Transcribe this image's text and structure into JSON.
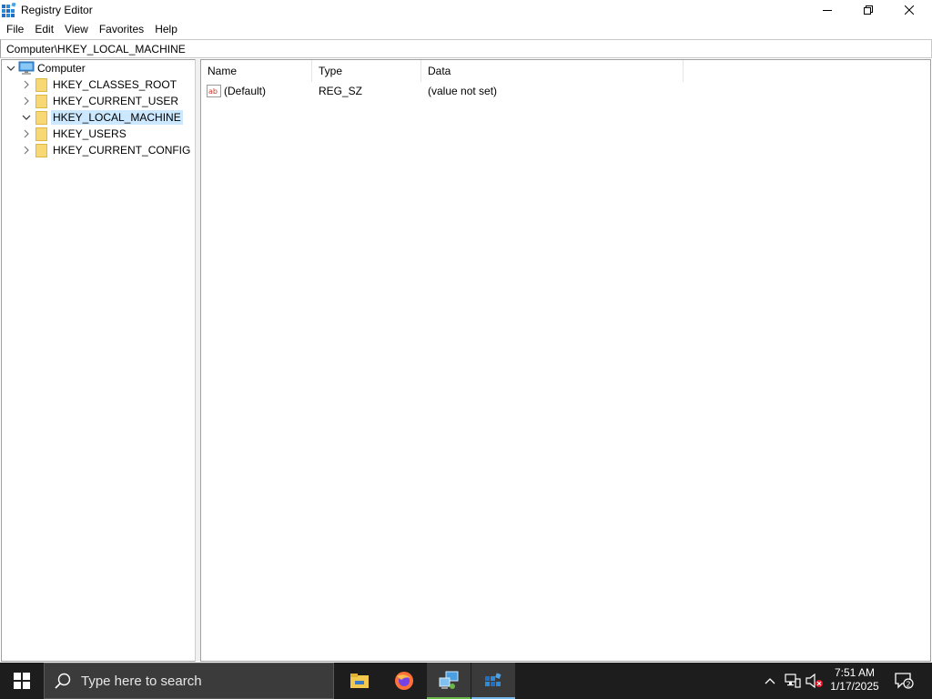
{
  "window": {
    "title": "Registry Editor",
    "controls": {
      "minimize": "minimize",
      "maximize": "restore",
      "close": "close"
    }
  },
  "menu": [
    "File",
    "Edit",
    "View",
    "Favorites",
    "Help"
  ],
  "address": {
    "value": "Computer\\HKEY_LOCAL_MACHINE"
  },
  "tree": {
    "root": {
      "label": "Computer",
      "expanded": true
    },
    "keys": [
      {
        "label": "HKEY_CLASSES_ROOT",
        "expanded": false,
        "selected": false
      },
      {
        "label": "HKEY_CURRENT_USER",
        "expanded": false,
        "selected": false
      },
      {
        "label": "HKEY_LOCAL_MACHINE",
        "expanded": true,
        "selected": true
      },
      {
        "label": "HKEY_USERS",
        "expanded": false,
        "selected": false
      },
      {
        "label": "HKEY_CURRENT_CONFIG",
        "expanded": false,
        "selected": false
      }
    ]
  },
  "list": {
    "columns": [
      "Name",
      "Type",
      "Data"
    ],
    "rows": [
      {
        "name": "(Default)",
        "type": "REG_SZ",
        "data": "(value not set)",
        "icon": "string-value-icon"
      }
    ]
  },
  "taskbar": {
    "search_placeholder": "Type here to search",
    "apps": [
      {
        "name": "file-explorer",
        "active": false
      },
      {
        "name": "firefox",
        "active": false
      },
      {
        "name": "network-tool",
        "active": true
      },
      {
        "name": "registry-editor",
        "active": true
      }
    ],
    "clock": {
      "time": "7:51 AM",
      "date": "1/17/2025"
    },
    "notifications": {
      "count": "2"
    }
  },
  "colors": {
    "selection": "#cce8ff",
    "taskbar": "#1d1d1d",
    "folder": "#f8d775",
    "accent": "#76b9ed"
  }
}
